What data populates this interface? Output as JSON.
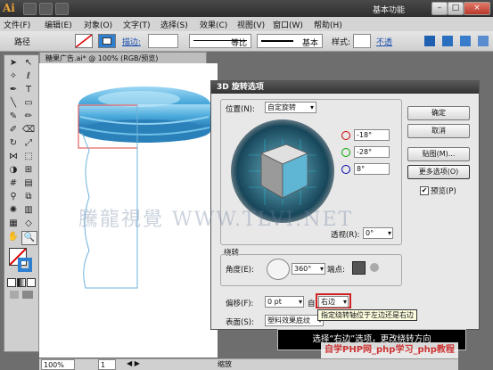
{
  "titlebar": {
    "logo": "Ai",
    "workspace": "基本功能",
    "win_min": "–",
    "win_max": "□",
    "win_close": "×"
  },
  "menubar": [
    "文件(F)",
    "编辑(E)",
    "对象(O)",
    "文字(T)",
    "选择(S)",
    "效果(C)",
    "视图(V)",
    "窗口(W)",
    "帮助(H)"
  ],
  "control": {
    "selection_label": "路径",
    "stroke_label": "描边:",
    "stroke_value": "",
    "profile_label": "等比",
    "brush_label": "基本",
    "style_label": "样式:",
    "opacity_link": "不透"
  },
  "document": {
    "tab_label": "糖果广告.ai* @ 100% (RGB/预览)"
  },
  "dialog": {
    "title": "3D 旋转选项",
    "position_label": "位置(N):",
    "position_value": "自定旋转",
    "angle_x": "-18°",
    "angle_y": "-28°",
    "angle_z": "8°",
    "perspective_label": "透视(R):",
    "perspective_value": "0°",
    "ok": "确定",
    "cancel": "取消",
    "map_art": "贴图(M)...",
    "more_options": "更多选项(O)",
    "preview_label": "预览(P)",
    "preview_checked": true,
    "revolve_group": "绕转",
    "angle_label": "角度(E):",
    "angle_value": "360°",
    "cap_label": "端点:",
    "offset_label": "偏移(F):",
    "offset_value": "0 pt",
    "from_label": "自",
    "from_value": "右边",
    "surface_label": "表面(S):",
    "surface_value": "塑料效果底纹"
  },
  "tooltip": "指定绕转轴位于左边还是右边",
  "callout": "选择“右边”选项，更改绕转方向",
  "status": {
    "zoom": "100%",
    "page": "1",
    "info": "缩放"
  },
  "watermark": "騰龍視覺 WWW.TLVI.NET",
  "site_logo": "自学PHP网_php学习_php教程",
  "colors": {
    "accent": "#2f7fd0",
    "dialog_title": "#3a3a3a",
    "object_fill": "#4da9d8",
    "highlight_border": "#d02020"
  }
}
